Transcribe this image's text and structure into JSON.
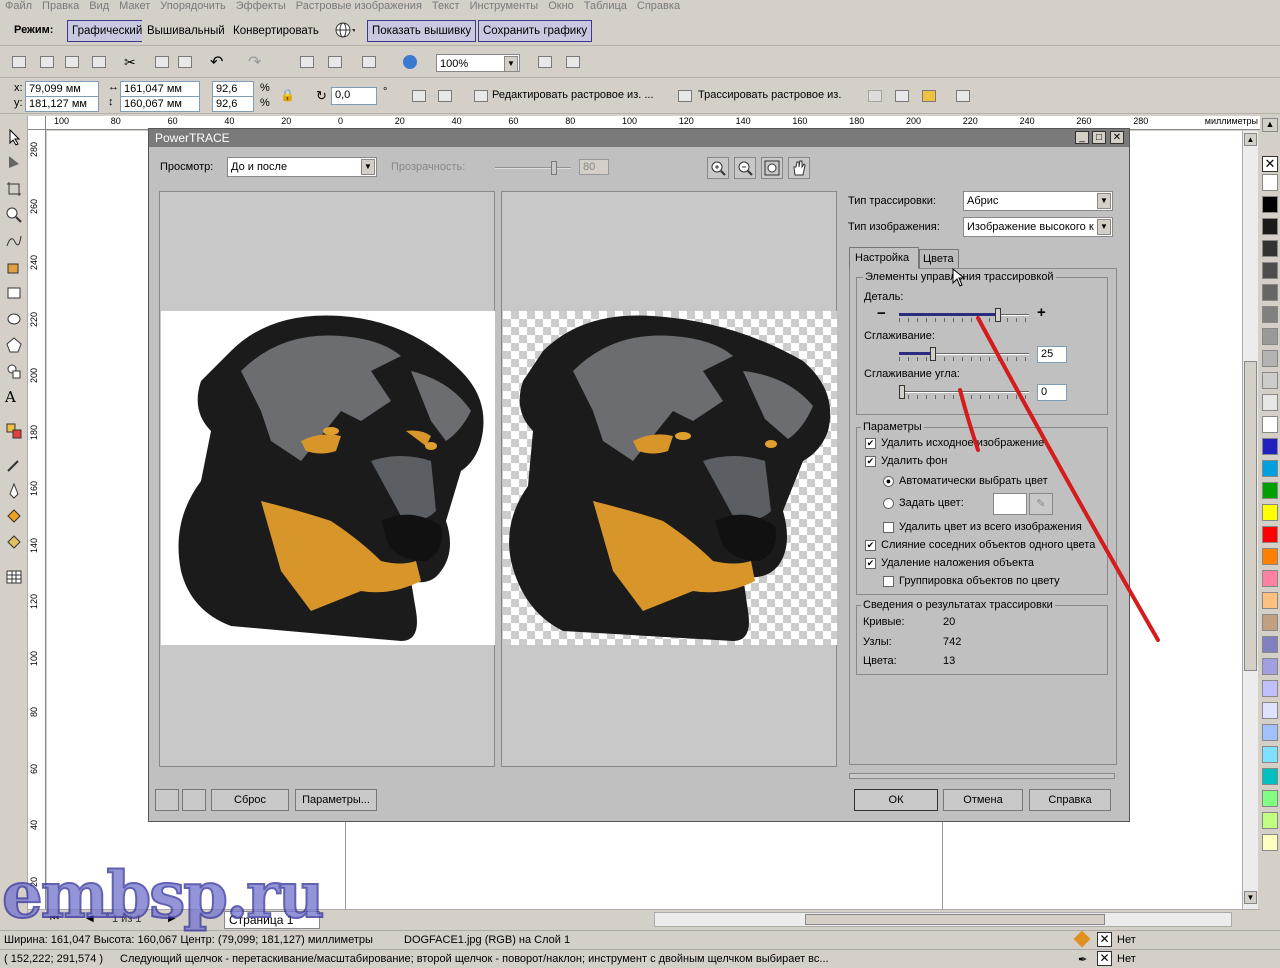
{
  "menu": [
    "Файл",
    "Правка",
    "Вид",
    "Макет",
    "Упорядочить",
    "Эффекты",
    "Растровые изображения",
    "Текст",
    "Инструменты",
    "Окно",
    "Таблица",
    "Справка"
  ],
  "toolbar1": {
    "mode_label": "Режим:",
    "mode_graphic": "Графический",
    "mode_embroidery": "Вышивальный",
    "convert": "Конвертировать",
    "show_embroidery": "Показать вышивку",
    "save_graphic": "Сохранить графику"
  },
  "toolbar2": {
    "zoom": "100%"
  },
  "propbar": {
    "x": "79,099 мм",
    "y": "181,127 мм",
    "w": "161,047 мм",
    "h": "160,067 мм",
    "sx": "92,6",
    "sy": "92,6",
    "pct": "%",
    "angle": "0,0",
    "deg": "°",
    "edit_bitmap": "Редактировать растровое из. ...",
    "trace_bitmap": "Трассировать растровое из."
  },
  "ruler": {
    "h_ticks": [
      "100",
      "80",
      "60",
      "40",
      "20",
      "0",
      "20",
      "40",
      "60",
      "80",
      "100",
      "120",
      "140",
      "160",
      "180",
      "200",
      "220",
      "240",
      "260",
      "280"
    ],
    "v_ticks": [
      "280",
      "260",
      "240",
      "220",
      "200",
      "180",
      "160",
      "140",
      "120",
      "100",
      "80",
      "60",
      "40",
      "20"
    ],
    "unit": "миллиметры"
  },
  "dialog": {
    "title": "PowerTRACE",
    "preview_label": "Просмотр:",
    "preview_value": "До и после",
    "transparency_label": "Прозрачность:",
    "transparency_value": "80",
    "trace_type_label": "Тип трассировки:",
    "trace_type_value": "Абрис",
    "image_type_label": "Тип изображения:",
    "image_type_value": "Изображение высокого к",
    "tab_settings": "Настройка",
    "tab_colors": "Цвета",
    "controls_group": "Элементы управления трассировкой",
    "detail_label": "Деталь:",
    "smoothing_label": "Сглаживание:",
    "smoothing_value": "25",
    "corner_label": "Сглаживание угла:",
    "corner_value": "0",
    "params_group": "Параметры",
    "opt_delete_original": "Удалить исходное изображение",
    "opt_remove_bg": "Удалить фон",
    "opt_auto_color": "Автоматически выбрать цвет",
    "opt_set_color": "Задать цвет:",
    "opt_remove_color_all": "Удалить цвет из всего изображения",
    "opt_merge_adjacent": "Слияние соседних объектов одного цвета",
    "opt_remove_overlap": "Удаление наложения объекта",
    "opt_group_by_color": "Группировка объектов по цвету",
    "results_group": "Сведения о результатах трассировки",
    "curves_label": "Кривые:",
    "curves_value": "20",
    "nodes_label": "Узлы:",
    "nodes_value": "742",
    "colors_label": "Цвета:",
    "colors_value": "13",
    "reset": "Сброс",
    "options": "Параметры...",
    "ok": "ОК",
    "cancel": "Отмена",
    "help": "Справка",
    "detail_level": 0.75,
    "smoothing_level": 0.25,
    "corner_level": 0.0
  },
  "pagenav": {
    "pages": "1 из 1",
    "page_tab": "Страница 1"
  },
  "status": {
    "line1": "Ширина: 161,047  Высота: 160,067  Центр: (79,099; 181,127)  миллиметры",
    "line1b": "DOGFACE1.jpg (RGB) на Слой 1",
    "line2": "( 152,222; 291,574 )",
    "line2b": "Следующий щелчок - перетаскивание/масштабирование; второй щелчок - поворот/наклон; инструмент с двойным щелчком выбирает вс...",
    "fill_none": "Нет",
    "outline_none": "Нет"
  },
  "watermark": "embsp.ru",
  "palette": [
    "#ffffff",
    "#000000",
    "#1a1a1a",
    "#333333",
    "#4d4d4d",
    "#666666",
    "#808080",
    "#999999",
    "#b3b3b3",
    "#cccccc",
    "#e6e6e6",
    "#ffffff",
    "#2020c0",
    "#00a0e0",
    "#00a000",
    "#ffff00",
    "#ff0000",
    "#ff8000",
    "#ff80a0",
    "#ffc080",
    "#c0a080",
    "#8080c0",
    "#a0a0e0",
    "#c0c0ff",
    "#e0e0ff",
    "#a0c0ff",
    "#80e0ff",
    "#00c0c0",
    "#80ff80",
    "#c0ff80",
    "#ffffc0"
  ]
}
